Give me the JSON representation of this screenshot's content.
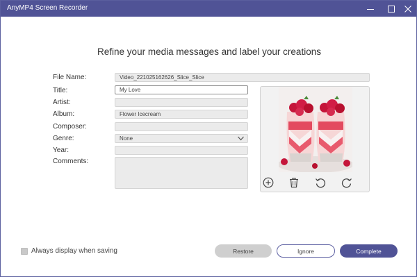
{
  "window": {
    "title": "AnyMP4 Screen Recorder"
  },
  "heading": "Refine your media messages and label your creations",
  "form": {
    "file_name": {
      "label": "File Name:",
      "value": "Video_221025162626_Slice_Slice"
    },
    "title": {
      "label": "Title:",
      "value": "My Love"
    },
    "artist": {
      "label": "Artist:",
      "value": ""
    },
    "album": {
      "label": "Album:",
      "value": "Flower Icecream"
    },
    "composer": {
      "label": "Composer:",
      "value": ""
    },
    "genre": {
      "label": "Genre:",
      "value": "None"
    },
    "year": {
      "label": "Year:",
      "value": ""
    },
    "comments": {
      "label": "Comments:",
      "value": ""
    }
  },
  "preview_tools": [
    "add-icon",
    "trash-icon",
    "rotate-left-icon",
    "rotate-right-icon"
  ],
  "options": {
    "always_display": {
      "label": "Always display when saving",
      "checked": false
    }
  },
  "buttons": {
    "restore": "Restore",
    "ignore": "Ignore",
    "complete": "Complete"
  },
  "colors": {
    "accent": "#505396",
    "field_bg": "#ebebeb",
    "button_disabled": "#cfcfcf"
  }
}
